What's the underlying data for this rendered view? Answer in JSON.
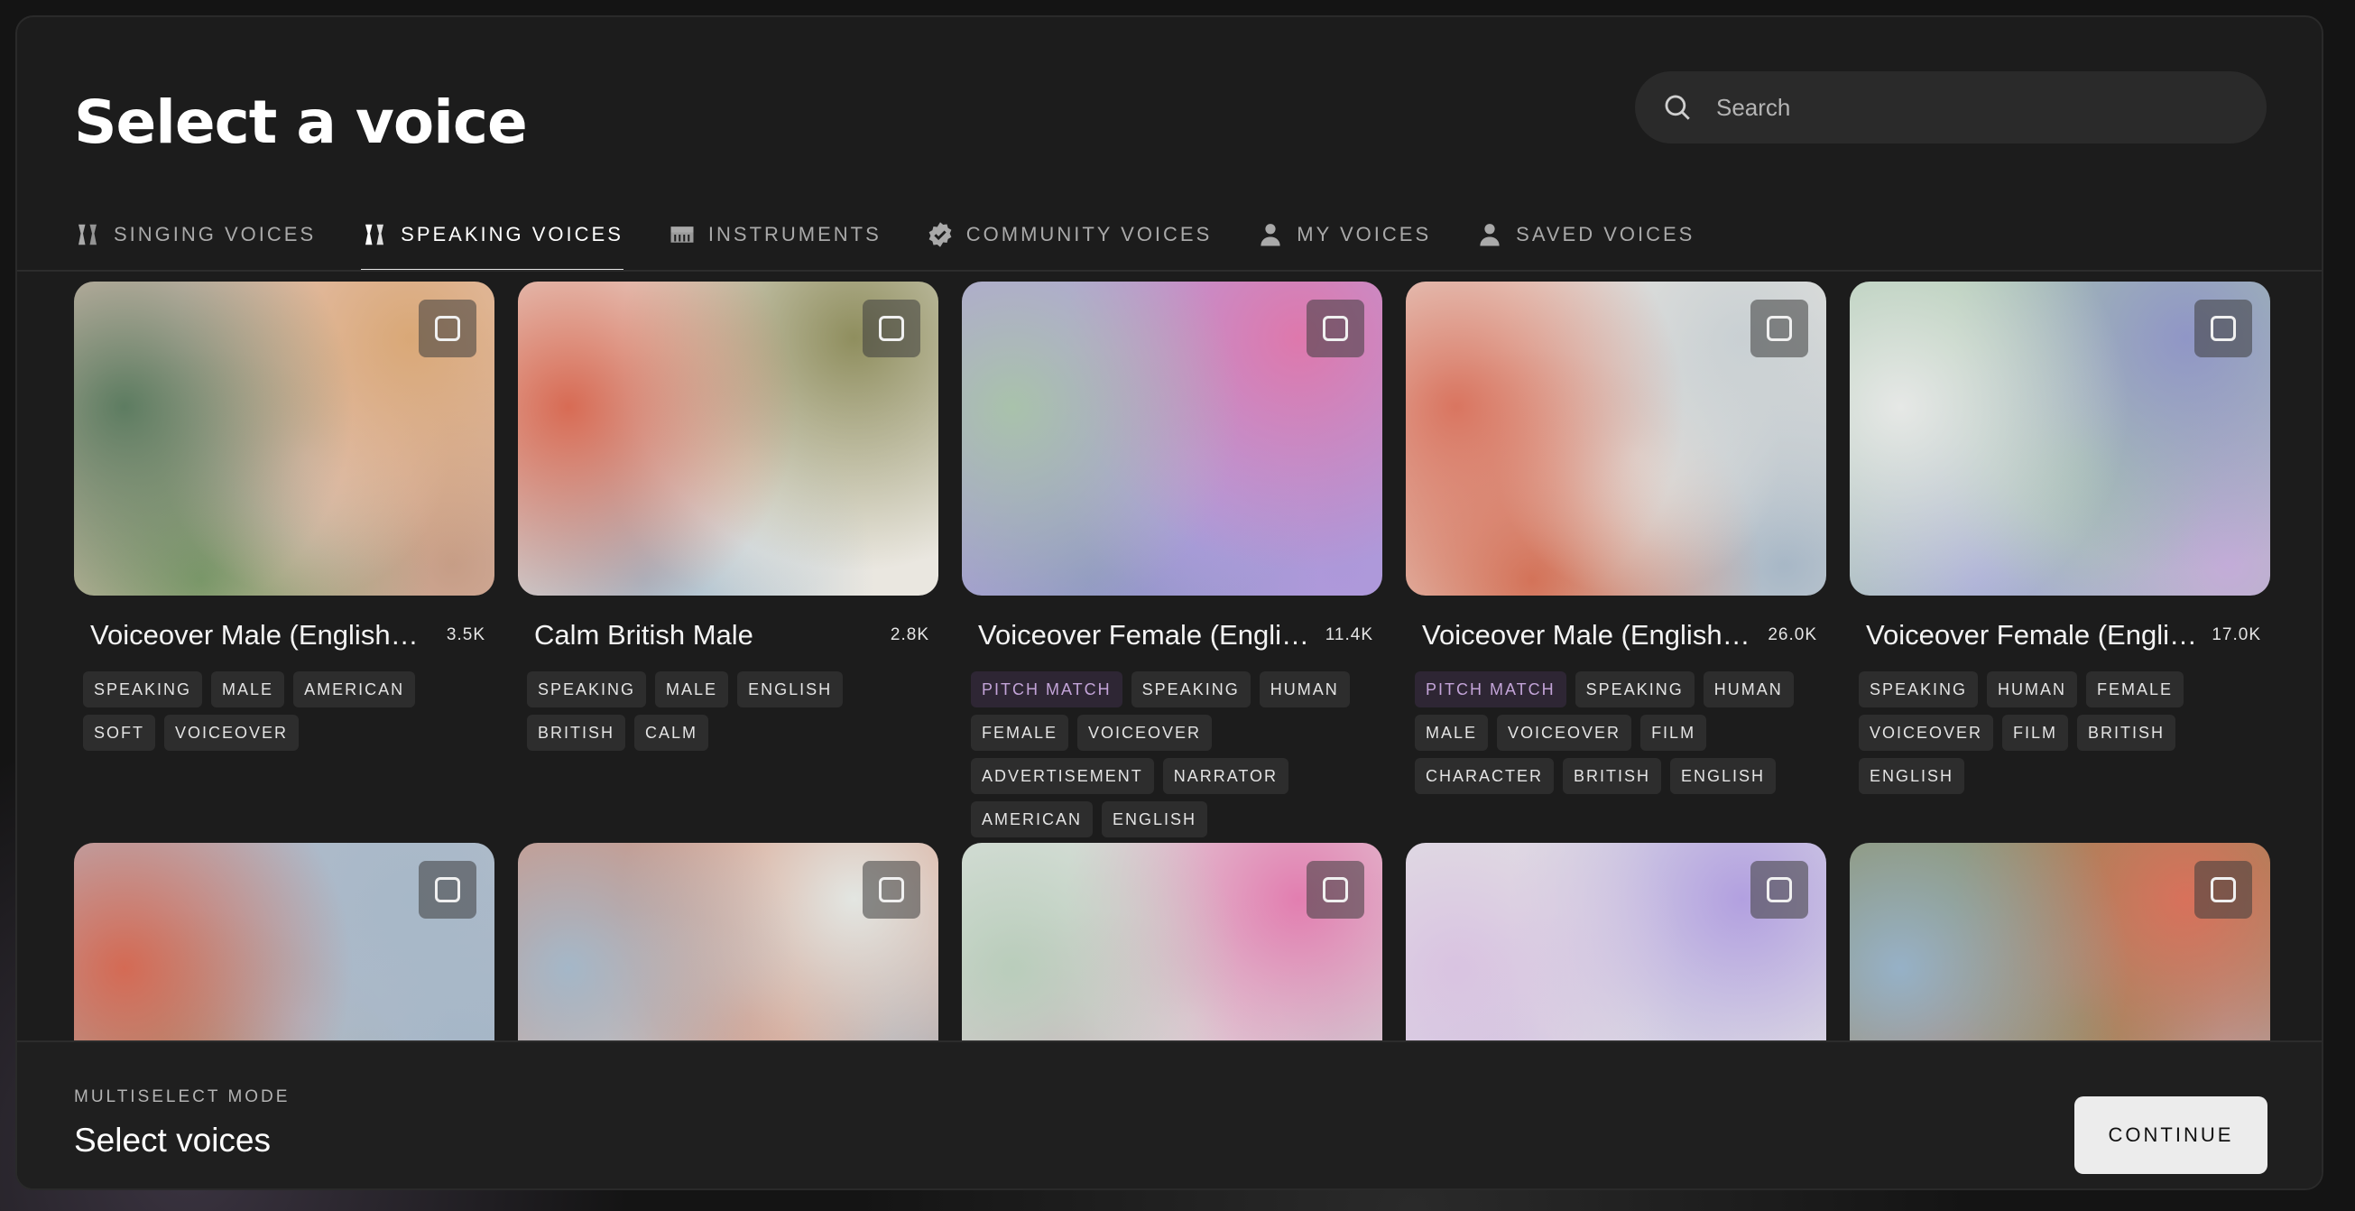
{
  "header": {
    "title": "Select a voice"
  },
  "search": {
    "placeholder": "Search"
  },
  "tabs": [
    {
      "label": "SINGING VOICES",
      "icon": "voice-mark-icon",
      "active": false
    },
    {
      "label": "SPEAKING VOICES",
      "icon": "voice-mark-icon",
      "active": true
    },
    {
      "label": "INSTRUMENTS",
      "icon": "piano-icon",
      "active": false
    },
    {
      "label": "COMMUNITY VOICES",
      "icon": "verified-badge-icon",
      "active": false
    },
    {
      "label": "MY VOICES",
      "icon": "person-icon",
      "active": false
    },
    {
      "label": "SAVED VOICES",
      "icon": "person-icon",
      "active": false
    }
  ],
  "voices": [
    {
      "title": "Voiceover Male (English, ...",
      "count": "3.5K",
      "tags": [
        "SPEAKING",
        "MALE",
        "AMERICAN",
        "SOFT",
        "VOICEOVER"
      ],
      "colors": [
        "#5d7c61",
        "#d9a877",
        "#e9c8bf",
        "#7f9c6a",
        "#c69d86"
      ]
    },
    {
      "title": "Calm British Male",
      "count": "2.8K",
      "tags": [
        "SPEAKING",
        "MALE",
        "ENGLISH",
        "BRITISH",
        "CALM"
      ],
      "colors": [
        "#d86b54",
        "#8f8e5e",
        "#ebe8e1",
        "#a5bccd",
        "#eae7e0"
      ]
    },
    {
      "title": "Voiceover Female (Englis...",
      "count": "11.4K",
      "tags": [
        "PITCH MATCH",
        "SPEAKING",
        "HUMAN",
        "FEMALE",
        "VOICEOVER",
        "ADVERTISEMENT",
        "NARRATOR",
        "AMERICAN",
        "ENGLISH"
      ],
      "colors": [
        "#a9c2ab",
        "#de78ac",
        "#b39fe0",
        "#9096c6",
        "#ad98d9"
      ]
    },
    {
      "title": "Voiceover Male (English (...",
      "count": "26.0K",
      "tags": [
        "PITCH MATCH",
        "SPEAKING",
        "HUMAN",
        "MALE",
        "VOICEOVER",
        "FILM",
        "CHARACTER",
        "BRITISH",
        "ENGLISH"
      ],
      "colors": [
        "#d97560",
        "#c9d0d3",
        "#ebe7e1",
        "#d27257",
        "#a7b7c6"
      ]
    },
    {
      "title": "Voiceover Female (English...",
      "count": "17.0K",
      "tags": [
        "SPEAKING",
        "HUMAN",
        "FEMALE",
        "VOICEOVER",
        "FILM",
        "BRITISH",
        "ENGLISH"
      ],
      "colors": [
        "#e6e8e6",
        "#9096c6",
        "#a8c7ad",
        "#a7abd6",
        "#c3acd8"
      ]
    },
    {
      "title": "",
      "count": "",
      "tags": [],
      "colors": [
        "#d46a54",
        "#a7b8c8",
        "#b3bccb",
        "#8a8c58",
        "#9eb2c4"
      ]
    },
    {
      "title": "",
      "count": "",
      "tags": [],
      "colors": [
        "#a4b7c8",
        "#e3e6e2",
        "#d68f76",
        "#e2dfdb",
        "#98adbf"
      ]
    },
    {
      "title": "",
      "count": "",
      "tags": [],
      "colors": [
        "#b9cdbb",
        "#e27eb0",
        "#e1e5e2",
        "#d785b1",
        "#c5d2d3"
      ]
    },
    {
      "title": "",
      "count": "",
      "tags": [],
      "colors": [
        "#d9c3e1",
        "#b2a0e0",
        "#e3e6e4",
        "#c6b8e0",
        "#e7e7e4"
      ]
    },
    {
      "title": "",
      "count": "",
      "tags": [],
      "colors": [
        "#96b1c7",
        "#d8715b",
        "#8c8d5a",
        "#d8715b",
        "#b9aec3"
      ]
    }
  ],
  "footer": {
    "mode_label": "MULTISELECT MODE",
    "select_label": "Select voices",
    "continue_label": "CONTINUE"
  }
}
